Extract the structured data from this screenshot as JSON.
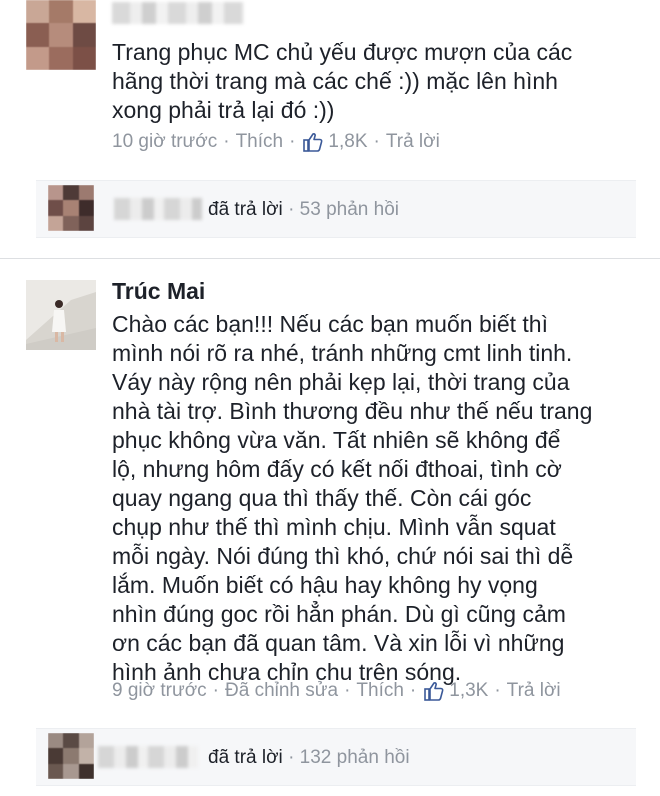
{
  "comment1": {
    "text_lines": [
      "Trang phục MC chủ yếu được mượn của các",
      "hãng thời trang mà các chế :)) mặc lên hình",
      "xong phải trả lại đó :))"
    ],
    "time": "10 giờ trước",
    "like_action": "Thích",
    "like_count": "1,8K",
    "reply_action": "Trả lời",
    "reply_summary": {
      "replied_text": "đã trả lời",
      "count_text": "53 phản hồi"
    }
  },
  "comment2": {
    "author": "Trúc Mai",
    "text_lines": [
      "Chào các bạn!!! Nếu các bạn muốn biết thì",
      "mình nói rõ ra nhé, tránh những cmt linh tinh.",
      "Váy này rộng nên phải kẹp lại, thời trang của",
      "nhà tài trợ. Bình thương đều như thế nếu trang",
      "phục không vừa văn. Tất nhiên sẽ không để",
      "lộ, nhưng hôm đấy có kết nối đthoai, tình cờ",
      "quay ngang qua thì thấy thế. Còn cái góc",
      "chụp như thế thì mình chịu. Mình vẫn squat",
      "mỗi ngày. Nói đúng thì khó, chứ nói sai thì dễ",
      "lắm. Muốn biết có hậu hay không hy vọng",
      "nhìn đúng goc rồi hẳn phán. Dù gì cũng cảm",
      "ơn các bạn đã quan tâm. Và xin lỗi vì những",
      "hình ảnh chưa chỉn chu trên sóng."
    ],
    "time": "9 giờ trước",
    "edited": "Đã chỉnh sửa",
    "like_action": "Thích",
    "like_count": "1,3K",
    "reply_action": "Trả lời",
    "reply_summary": {
      "replied_text": "đã trả lời",
      "count_text": "132 phản hồi"
    }
  },
  "separator": "·",
  "icons": {
    "like": "thumbs-up-icon"
  },
  "colors": {
    "text": "#1d2129",
    "meta": "#8f959e",
    "like_icon": "#3b5998",
    "reply_bar_bg": "#f6f7f9"
  }
}
